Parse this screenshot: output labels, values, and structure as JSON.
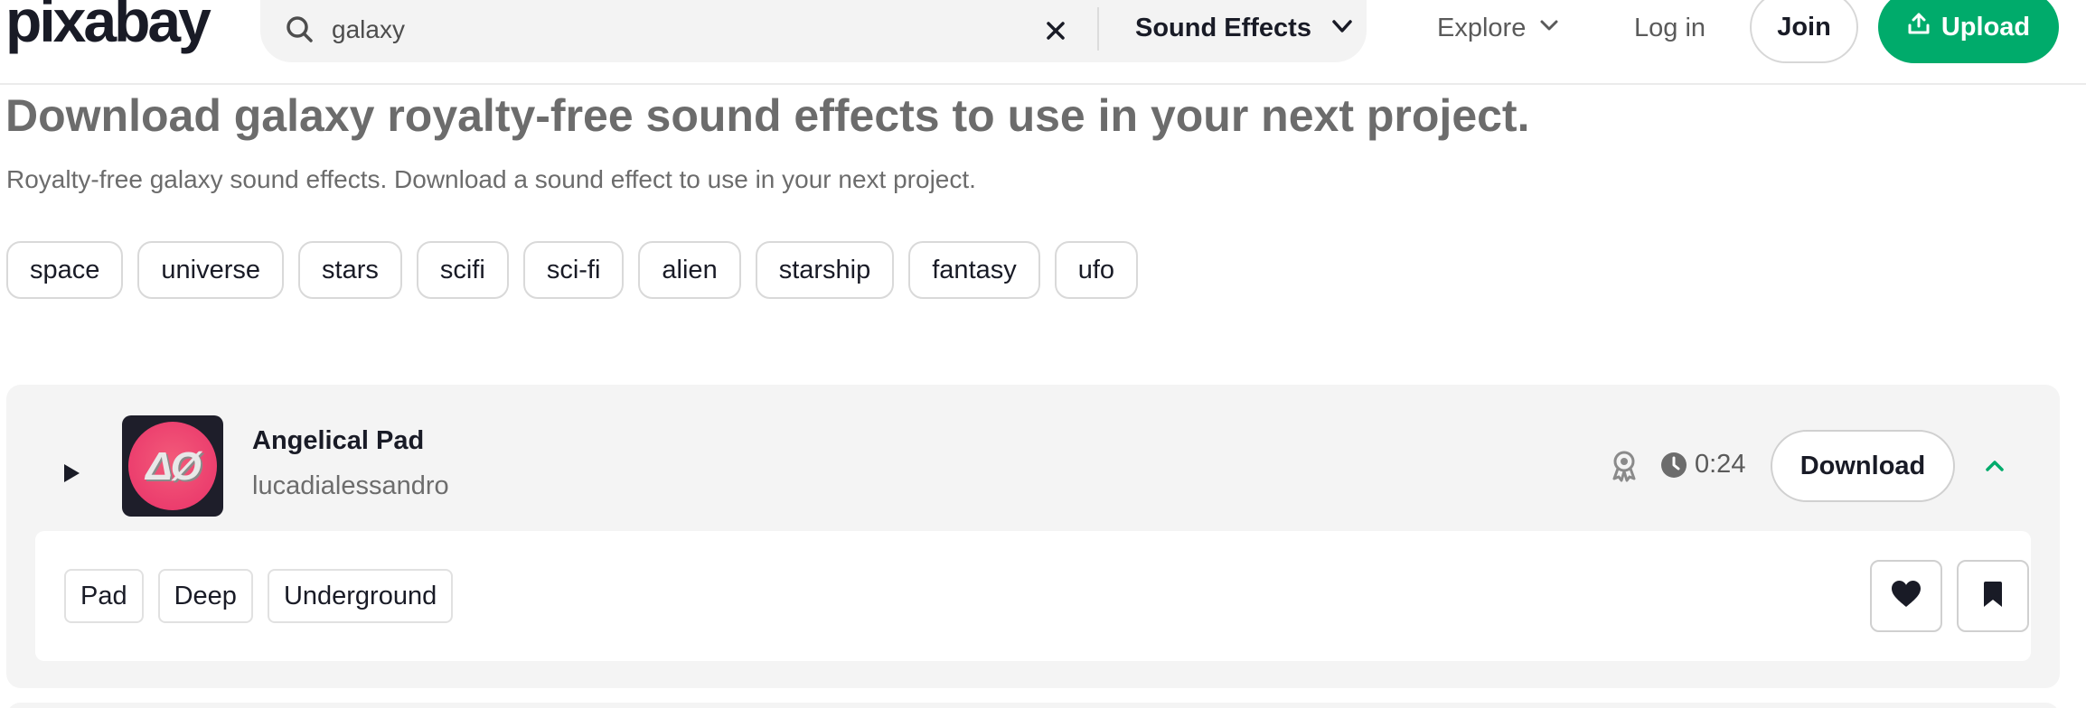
{
  "header": {
    "logo_text": "pixabay",
    "search": {
      "value": "galaxy",
      "placeholder": "Search"
    },
    "media_type": "Sound Effects",
    "explore_label": "Explore",
    "login_label": "Log in",
    "join_label": "Join",
    "upload_label": "Upload",
    "accent_color": "#00ab6b"
  },
  "page": {
    "title": "Download galaxy royalty-free sound effects to use in your next project.",
    "subtitle": "Royalty-free galaxy sound effects. Download a sound effect to use in your next project."
  },
  "related_tags": [
    "space",
    "universe",
    "stars",
    "scifi",
    "sci-fi",
    "alien",
    "starship",
    "fantasy",
    "ufo"
  ],
  "results": [
    {
      "title": "Angelical Pad",
      "author": "lucadialessandro",
      "cover_text": "ΔØ",
      "duration": "0:24",
      "download_label": "Download",
      "tags": [
        "Pad",
        "Deep",
        "Underground"
      ]
    }
  ],
  "icons": {
    "search": "search-icon",
    "clear": "close-icon",
    "dropdown": "chevron-down-icon",
    "upload": "upload-icon",
    "play": "play-icon",
    "award": "award-icon",
    "clock": "clock-icon",
    "collapse": "chevron-up-icon",
    "like": "heart-icon",
    "save": "bookmark-icon"
  }
}
